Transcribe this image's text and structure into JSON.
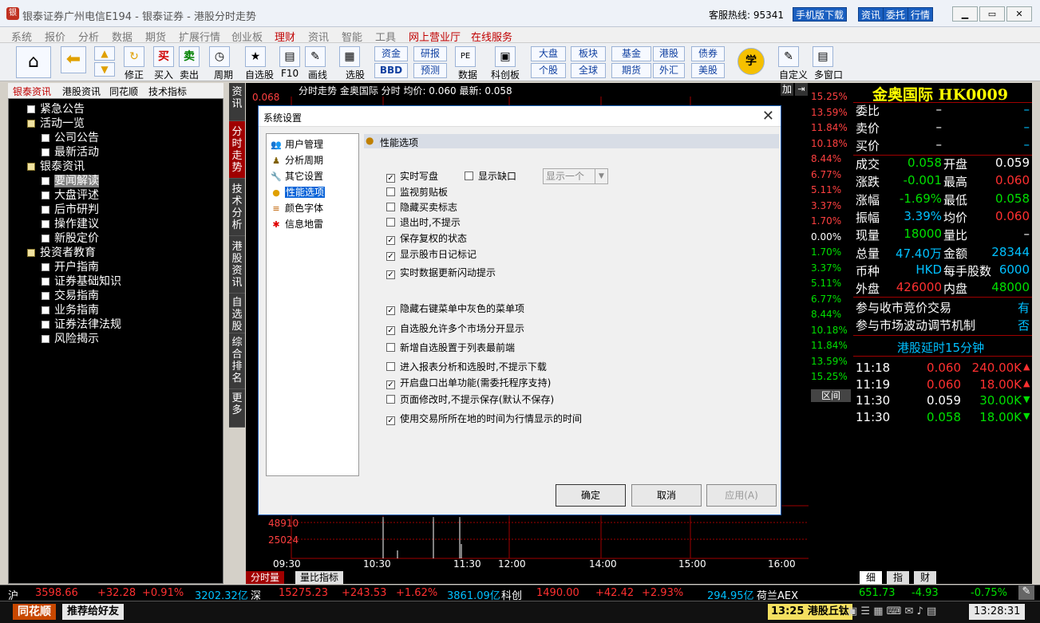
{
  "window": {
    "title": "银泰证券广州电信E194 - 银泰证券 - 港股分时走势",
    "hotline_label": "客服热线:",
    "hotline": "95341",
    "top_buttons": [
      "手机版下载",
      "资讯",
      "委托",
      "行情"
    ]
  },
  "menu": [
    "系统",
    "报价",
    "分析",
    "数据",
    "期货",
    "扩展行情",
    "创业板",
    "理财",
    "资讯",
    "智能",
    "工具",
    "网上营业厅",
    "在线服务"
  ],
  "toolbar": {
    "labels": [
      "买入",
      "卖出",
      "周期",
      "自选股",
      "F10",
      "画线",
      "选股",
      "数据",
      "科创板",
      "自定义",
      "多窗口",
      "修正"
    ],
    "buy": "买",
    "sell": "卖",
    "group_buttons": [
      "资金",
      "研报",
      "板块",
      "基金",
      "港股",
      "债券",
      "BBD",
      "预测",
      "个股",
      "全球",
      "期货",
      "外汇",
      "美股"
    ],
    "learn": "学"
  },
  "left_panel": {
    "tabs": [
      "银泰资讯",
      "港股资讯",
      "同花顺",
      "技术指标"
    ],
    "tree": [
      {
        "label": "紧急公告",
        "level": 1,
        "type": "item"
      },
      {
        "label": "活动一览",
        "level": 1,
        "type": "folder"
      },
      {
        "label": "公司公告",
        "level": 2,
        "type": "item"
      },
      {
        "label": "最新活动",
        "level": 2,
        "type": "item"
      },
      {
        "label": "银泰资讯",
        "level": 1,
        "type": "folder"
      },
      {
        "label": "要闻解读",
        "level": 2,
        "type": "item",
        "selected": true
      },
      {
        "label": "大盘评述",
        "level": 2,
        "type": "item"
      },
      {
        "label": "后市研判",
        "level": 2,
        "type": "item"
      },
      {
        "label": "操作建议",
        "level": 2,
        "type": "item"
      },
      {
        "label": "新股定价",
        "level": 2,
        "type": "item"
      },
      {
        "label": "投资者教育",
        "level": 1,
        "type": "folder"
      },
      {
        "label": "开户指南",
        "level": 2,
        "type": "item"
      },
      {
        "label": "证券基础知识",
        "level": 2,
        "type": "item"
      },
      {
        "label": "交易指南",
        "level": 2,
        "type": "item"
      },
      {
        "label": "业务指南",
        "level": 2,
        "type": "item"
      },
      {
        "label": "证券法律法规",
        "level": 2,
        "type": "item"
      },
      {
        "label": "风险揭示",
        "level": 2,
        "type": "item"
      }
    ]
  },
  "vertical_tabs": [
    "资讯",
    "分时走势",
    "技术分析",
    "港股资讯",
    "自选股",
    "综合排名",
    "更多"
  ],
  "chart": {
    "header": "分时走势  金奥国际 分时 均价: 0.060 最新: 0.058",
    "top_price": "0.068",
    "volume_labels": [
      "48910",
      "25024"
    ],
    "x_ticks": [
      "09:30",
      "10:30",
      "11:30",
      "12:00",
      "14:00",
      "15:00",
      "16:00"
    ],
    "pct_labels": [
      "15.25%",
      "13.59%",
      "11.84%",
      "10.18%",
      "8.44%",
      "6.77%",
      "5.11%",
      "3.37%",
      "1.70%",
      "0.00%",
      "1.70%",
      "3.37%",
      "5.11%",
      "6.77%",
      "8.44%",
      "10.18%",
      "11.84%",
      "13.59%",
      "15.25%"
    ],
    "bottom_tabs": [
      "分时量",
      "量比指标"
    ],
    "add_label": "加",
    "zone_label": "区间"
  },
  "right_panel": {
    "title": "金奥国际 HK0009",
    "rows1": [
      {
        "l": "委比",
        "v": "–"
      },
      {
        "l": "卖价",
        "v": "–"
      },
      {
        "l": "买价",
        "v": "–"
      }
    ],
    "rows2": [
      {
        "l1": "成交",
        "v1": "0.058",
        "l2": "开盘",
        "v2": "0.059"
      },
      {
        "l1": "涨跌",
        "v1": "-0.001",
        "l2": "最高",
        "v2": "0.060"
      },
      {
        "l1": "涨幅",
        "v1": "-1.69%",
        "l2": "最低",
        "v2": "0.058"
      },
      {
        "l1": "振幅",
        "v1": "3.39%",
        "l2": "均价",
        "v2": "0.060"
      },
      {
        "l1": "现量",
        "v1": "18000",
        "l2": "量比",
        "v2": "–"
      },
      {
        "l1": "总量",
        "v1": "47.40万",
        "l2": "金额",
        "v2": "28344"
      },
      {
        "l1": "币种",
        "v1": "HKD",
        "l2": "每手股数",
        "v2": "6000"
      },
      {
        "l1": "外盘",
        "v1": "426000",
        "l2": "内盘",
        "v2": "48000"
      }
    ],
    "flags": [
      {
        "l": "参与收市竞价交易",
        "v": "有"
      },
      {
        "l": "参与市场波动调节机制",
        "v": "否"
      }
    ],
    "delay": "港股延时15分钟",
    "ticks": [
      {
        "t": "11:18",
        "p": "0.060",
        "v": "240.00K"
      },
      {
        "t": "11:19",
        "p": "0.060",
        "v": "18.00K"
      },
      {
        "t": "11:30",
        "p": "0.059",
        "v": "30.00K"
      },
      {
        "t": "11:30",
        "p": "0.058",
        "v": "18.00K"
      }
    ],
    "bottom_tabs": [
      "细",
      "指",
      "财"
    ]
  },
  "status": {
    "sh": "沪",
    "sh_idx": "3598.66",
    "sh_chg": "+32.28",
    "sh_pct": "+0.91%",
    "sh_amt": "3202.32亿",
    "sz": "深",
    "sz_idx": "15275.23",
    "sz_chg": "+243.53",
    "sz_pct": "+1.62%",
    "sz_amt": "3861.09亿",
    "kc": "科创",
    "kc_idx": "1490.00",
    "kc_chg": "+42.42",
    "kc_pct": "+2.93%",
    "kc_amt": "294.95亿",
    "aex": "荷兰AEX",
    "aex_idx": "651.73",
    "aex_chg": "-4.93",
    "aex_pct": "-0.75%"
  },
  "footer": {
    "brand": "同花顺",
    "recommend": "推荐给好友",
    "ticker": "13:25 港股丘钛",
    "clock": "13:28:31"
  },
  "dialog": {
    "title": "系统设置",
    "close": "✕",
    "tree": [
      {
        "label": "用户管理",
        "icon": "users"
      },
      {
        "label": "分析周期",
        "icon": "period"
      },
      {
        "label": "其它设置",
        "icon": "wrench"
      },
      {
        "label": "性能选项",
        "icon": "perf",
        "selected": true
      },
      {
        "label": "颜色字体",
        "icon": "color"
      },
      {
        "label": "信息地雷",
        "icon": "mine"
      }
    ],
    "section_title": "性能选项",
    "options": [
      {
        "label": "实时写盘",
        "checked": true
      },
      {
        "label": "显示缺口",
        "checked": false
      },
      {
        "label": "监视剪贴板",
        "checked": false
      },
      {
        "label": "隐藏买卖标志",
        "checked": false
      },
      {
        "label": "退出时,不提示",
        "checked": false
      },
      {
        "label": "保存复权的状态",
        "checked": true
      },
      {
        "label": "显示股市日记标记",
        "checked": true
      },
      {
        "label": "实时数据更新闪动提示",
        "checked": true
      },
      {
        "label": "隐藏右键菜单中灰色的菜单项",
        "checked": true
      },
      {
        "label": "自选股允许多个市场分开显示",
        "checked": true
      },
      {
        "label": "新增自选股置于列表最前端",
        "checked": false
      },
      {
        "label": "进入报表分析和选股时,不提示下载",
        "checked": false
      },
      {
        "label": "开启盘口出单功能(需委托程序支持)",
        "checked": true
      },
      {
        "label": "页面修改时,不提示保存(默认不保存)",
        "checked": false
      },
      {
        "label": "使用交易所所在地的时间为行情显示的时间",
        "checked": true
      }
    ],
    "gap_select": "显示一个",
    "buttons": {
      "ok": "确定",
      "cancel": "取消",
      "apply": "应用(A)"
    }
  }
}
